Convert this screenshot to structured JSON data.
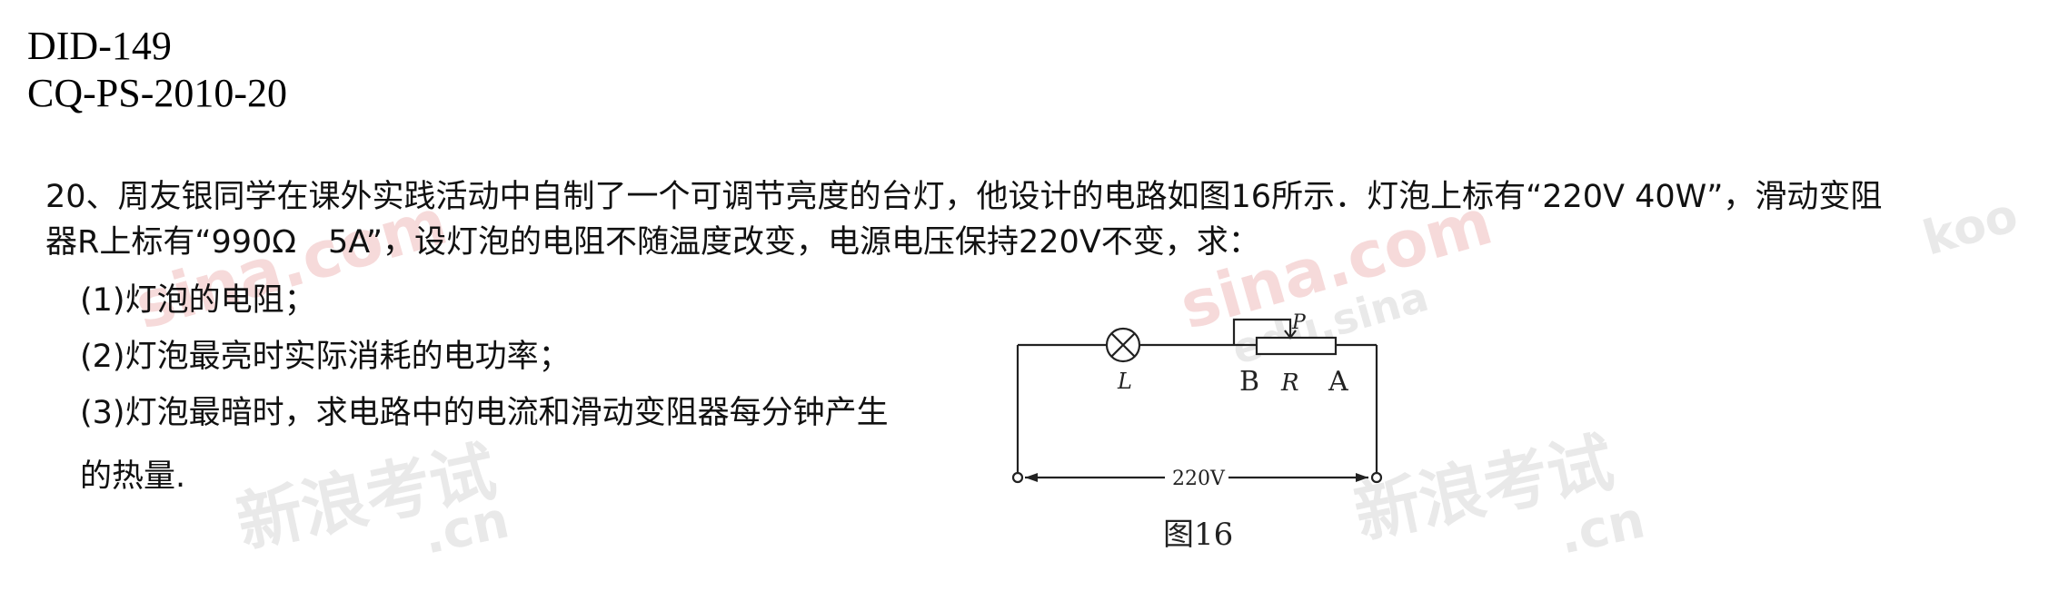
{
  "doc": {
    "id_line_1": "DID-149",
    "id_line_2": "CQ-PS-2010-20"
  },
  "question": {
    "line_1": "20、周友银同学在课外实践活动中自制了一个可调节亮度的台灯，他设计的电路如图16所示．灯泡上标有“220V 40W”，滑动变阻",
    "line_2": "器R上标有“990Ω　5A”，设灯泡的电阻不随温度改变，电源电压保持220V不变，求：",
    "sub_1": "(1)灯泡的电阻；",
    "sub_2": "(2)灯泡最亮时实际消耗的电功率；",
    "sub_3": "(3)灯泡最暗时，求电路中的电流和滑动变阻器每分钟产生",
    "sub_3_cont": "的热量."
  },
  "figure": {
    "lamp_label": "L",
    "slider_label": "P",
    "terminal_b": "B",
    "resistor_label": "R",
    "terminal_a": "A",
    "voltage_label": "220V",
    "caption": "图16"
  },
  "watermarks": {
    "w1": "新浪考试",
    "w2": "新浪考试",
    "w3": "sina.com",
    "w4": "sina.com",
    "w5": ".cn",
    "w6": ".cn",
    "w7": "edu.sina",
    "w8": "koo"
  },
  "colors": {
    "text": "#111111",
    "watermark_gray": "#e9e9e9",
    "watermark_pink": "#f6dada"
  }
}
